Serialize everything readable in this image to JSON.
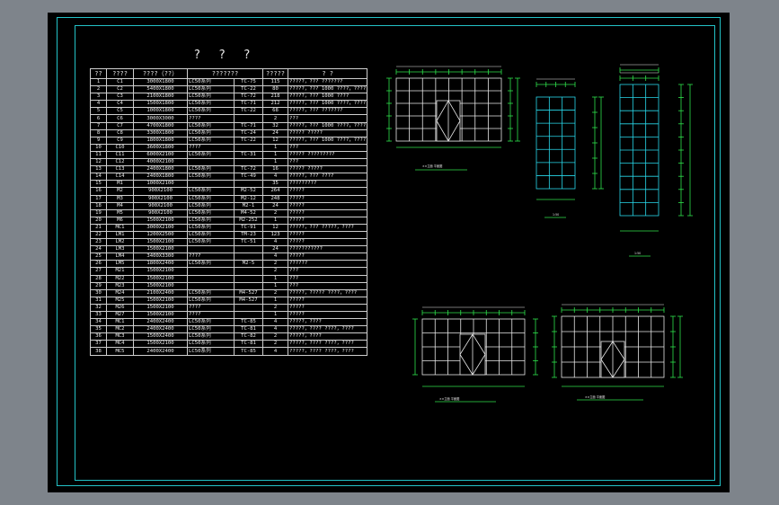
{
  "drawing": {
    "title": "? ? ?",
    "columns": [
      "??",
      "????",
      "????（??）",
      "???????",
      "?????",
      "? ?"
    ],
    "rows": [
      [
        "1",
        "C1",
        "3000X1800",
        "LC50系列",
        "TC-75",
        "115",
        "?????，???  ???????"
      ],
      [
        "2",
        "C2",
        "5400X1800",
        "LC50系列",
        "TC-22",
        "80",
        "?????，??? 1000 ????，????"
      ],
      [
        "3",
        "C3",
        "2100X1800",
        "LC50系列",
        "TC-72",
        "218",
        "?????，??? 1000 ????"
      ],
      [
        "4",
        "C4",
        "1500X1800",
        "LC50系列",
        "TC-71",
        "212",
        "?????，??? 1000 ????，????"
      ],
      [
        "5",
        "C5",
        "1000X1800",
        "LC50系列",
        "TC-22",
        "68",
        "?????，???  ???????"
      ],
      [
        "6",
        "C6",
        "3000X3000",
        "????",
        "",
        "2",
        "???"
      ],
      [
        "7",
        "C7",
        "4700X1800",
        "LC50系列",
        "TC-71",
        "32",
        "?????，??? 1000 ????，????"
      ],
      [
        "8",
        "C8",
        "3300X1800",
        "LC50系列",
        "TC-24",
        "24",
        "?????  ?????"
      ],
      [
        "9",
        "C9",
        "1800X1800",
        "LC50系列",
        "TC-22",
        "12",
        "?????，??? 1000 ????，????"
      ],
      [
        "10",
        "C10",
        "3600X1800",
        "????",
        "",
        "1",
        "???"
      ],
      [
        "11",
        "C11",
        "6000X2100",
        "LC50系列",
        "TC-31",
        "1",
        "?????  ?????????"
      ],
      [
        "12",
        "C12",
        "4000X2100",
        "",
        "",
        "1",
        "???"
      ],
      [
        "13",
        "C13",
        "2400X1800",
        "LC50系列",
        "TC-72",
        "16",
        "?????  ?????"
      ],
      [
        "14",
        "C14",
        "2400X1800",
        "LC50系列",
        "TC-49",
        "4",
        "?????，???  ????"
      ],
      [
        "15",
        "M1",
        "1000X2100",
        "",
        "",
        "35",
        "?????????"
      ],
      [
        "16",
        "M2",
        "900X2100",
        "LC50系列",
        "M2-52",
        "264",
        "?????"
      ],
      [
        "17",
        "M3",
        "900X2100",
        "LC50系列",
        "M2-12",
        "248",
        "?????"
      ],
      [
        "18",
        "M4",
        "900X2100",
        "LC50系列",
        "M2-1",
        "24",
        "?????"
      ],
      [
        "19",
        "M5",
        "900X2100",
        "LC50系列",
        "M4-52",
        "2",
        "?????"
      ],
      [
        "20",
        "M6",
        "1500X2100",
        "LC50系列",
        "M2-252",
        "1",
        "?????"
      ],
      [
        "21",
        "MC1",
        "3000X2100",
        "LC50系列",
        "TC-91",
        "12",
        "?????，???  ?????，????"
      ],
      [
        "22",
        "LM1",
        "1200X2500",
        "LC50系列",
        "TM-23",
        "123",
        "?????"
      ],
      [
        "23",
        "LM2",
        "1500X2100",
        "LC50系列",
        "TC-51",
        "4",
        "?????"
      ],
      [
        "24",
        "LM3",
        "1500X2100",
        "",
        "",
        "24",
        "???????????"
      ],
      [
        "25",
        "LM4",
        "3400X3300",
        "????",
        "",
        "4",
        "?????"
      ],
      [
        "26",
        "LM5",
        "1800X2400",
        "LC50系列",
        "M2-5",
        "2",
        "??????"
      ],
      [
        "27",
        "M21",
        "1500X2100",
        "",
        "",
        "2",
        "???"
      ],
      [
        "28",
        "M22",
        "1500X2100",
        "",
        "",
        "1",
        "???"
      ],
      [
        "29",
        "M23",
        "1500X2100",
        "",
        "",
        "1",
        "???"
      ],
      [
        "30",
        "M24",
        "2100X2400",
        "LC50系列",
        "M4-527",
        "2",
        "?????，?????  ????，????"
      ],
      [
        "31",
        "M25",
        "1500X2100",
        "LC50系列",
        "M4-527",
        "1",
        "?????"
      ],
      [
        "32",
        "M26",
        "1500X2100",
        "????",
        "",
        "2",
        "?????"
      ],
      [
        "33",
        "M27",
        "1500X2100",
        "????",
        "",
        "1",
        "?????"
      ],
      [
        "34",
        "MC1",
        "2400X2400",
        "LC50系列",
        "TC-85",
        "4",
        "?????，????"
      ],
      [
        "35",
        "MC2",
        "2400X2400",
        "LC50系列",
        "TC-81",
        "4",
        "?????，????  ????，????"
      ],
      [
        "36",
        "MC3",
        "1500X2400",
        "LC50系列",
        "TC-82",
        "2",
        "?????，????"
      ],
      [
        "37",
        "MC4",
        "1500X2100",
        "LC50系列",
        "TC-81",
        "2",
        "?????，????  ????，????"
      ],
      [
        "38",
        "MC5",
        "2400X2400",
        "LC50系列",
        "TC-85",
        "4",
        "?????，????  ????，????"
      ]
    ]
  },
  "elevations": {
    "label_a": "××立面 平面图",
    "label_b": "××立面 平面图",
    "label_c": "××立面 平面图",
    "scale_tag": "1:50"
  },
  "colors": {
    "sheet": "#000000",
    "frame": "#23c2c7",
    "lines": "#e8e8e8",
    "dimension": "#2fe24c",
    "glazing": "#28d8ea",
    "backdrop": "#7e848b"
  }
}
